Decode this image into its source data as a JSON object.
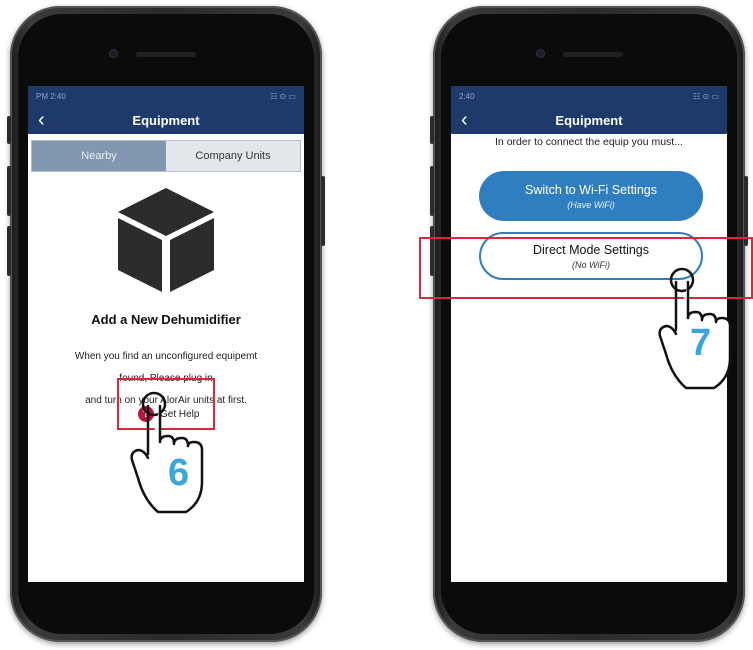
{
  "left_phone": {
    "status_time": "PM 2:40",
    "status_icons": "☷ ⊙ ▭",
    "nav_title": "Equipment",
    "back_glyph": "‹",
    "tabs": [
      {
        "label": "Nearby",
        "active": true
      },
      {
        "label": "Company Units",
        "active": false
      }
    ],
    "heading": "Add a New Dehumidifier",
    "instructions": [
      "When you find an unconfigured equipemt",
      "found, Please plug in",
      "and turn on your AlorAir units at first."
    ],
    "help_icon": "question-mark-icon",
    "help_label": "Get Help",
    "step_number": "6"
  },
  "right_phone": {
    "status_time": "2:40",
    "status_icons": "☷ ⊙ ▭",
    "nav_title": "Equipment",
    "back_glyph": "‹",
    "intro": "In order to connect the equip you must...",
    "wifi_button": {
      "label": "Switch to Wi-Fi Settings",
      "sub": "(Have WiFi)"
    },
    "direct_button": {
      "label": "Direct Mode Settings",
      "sub": "(No WiFi)"
    },
    "step_number": "7"
  },
  "colors": {
    "nav_bar": "#1e3a6b",
    "tab_active": "#8297b0",
    "tab_inactive": "#e3e6ea",
    "primary_button": "#2f7fc0",
    "help_icon": "#b8163c",
    "highlight_box": "#d8283a",
    "step_number": "#3aa6df"
  }
}
